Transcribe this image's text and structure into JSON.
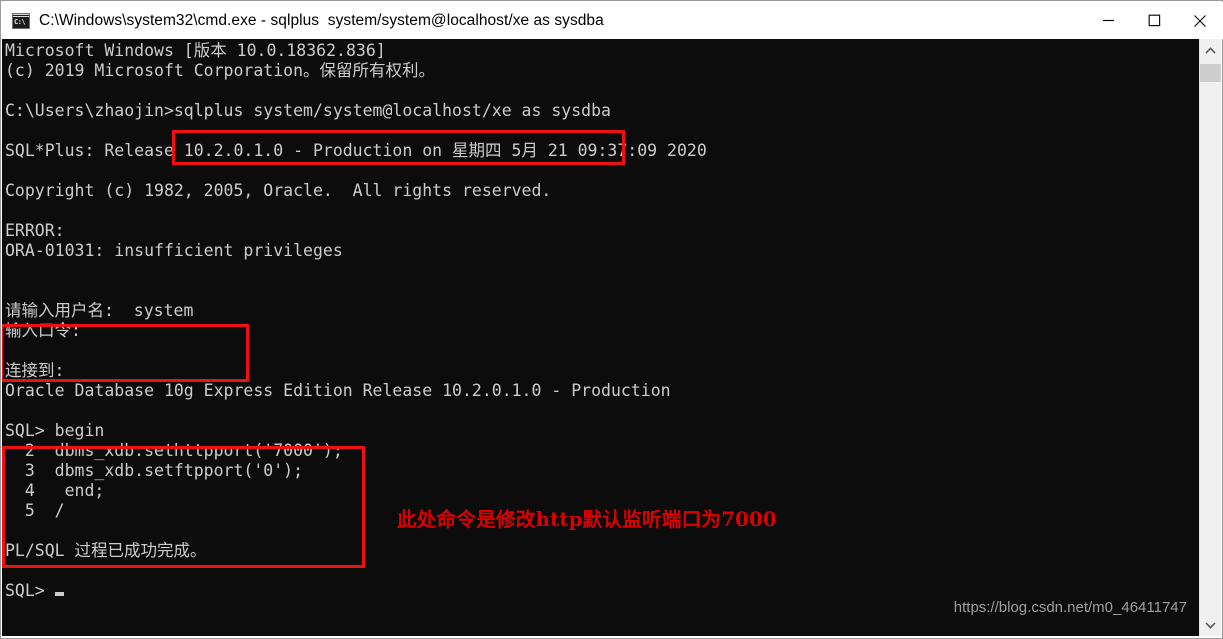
{
  "window": {
    "title": "C:\\Windows\\system32\\cmd.exe - sqlplus  system/system@localhost/xe as sysdba",
    "icon_glyph": "C:\\",
    "minimize_label": "—",
    "maximize_label": "□",
    "close_label": "✕"
  },
  "console": {
    "background": "#0c0c0c",
    "foreground": "#cccccc",
    "lines": [
      "Microsoft Windows [版本 10.0.18362.836]",
      "(c) 2019 Microsoft Corporation。保留所有权利。",
      "",
      "C:\\Users\\zhaojin>sqlplus system/system@localhost/xe as sysdba",
      "",
      "SQL*Plus: Release 10.2.0.1.0 - Production on 星期四 5月 21 09:37:09 2020",
      "",
      "Copyright (c) 1982, 2005, Oracle.  All rights reserved.",
      "",
      "ERROR:",
      "ORA-01031: insufficient privileges",
      "",
      "",
      "请输入用户名:  system",
      "输入口令:",
      "",
      "连接到:",
      "Oracle Database 10g Express Edition Release 10.2.0.1.0 - Production",
      "",
      "SQL> begin",
      "  2  dbms_xdb.sethttpport('7000');",
      "  3  dbms_xdb.setftpport('0');",
      "  4   end;",
      "  5  /",
      "",
      "PL/SQL 过程已成功完成。",
      "",
      "SQL>"
    ]
  },
  "annotations": {
    "highlight_color": "#ee1111",
    "boxes": [
      {
        "name": "sqlplus-command",
        "label": "sqlplus system/system@localhost/xe as sysdba"
      },
      {
        "name": "login-prompt",
        "label": "请输入用户名:  system / 输入口令:"
      },
      {
        "name": "sql-block",
        "label": "begin dbms_xdb.sethttpport('7000'); dbms_xdb.setftpport('0'); end; /"
      }
    ],
    "note_text": "此处命令是修改http默认监听端口为7000",
    "note_color": "#dd0000"
  },
  "watermark": {
    "text": "https://blog.csdn.net/m0_46411747"
  },
  "scrollbar": {
    "up_arrow": "ⱏ",
    "down_arrow": "ⱟ"
  }
}
